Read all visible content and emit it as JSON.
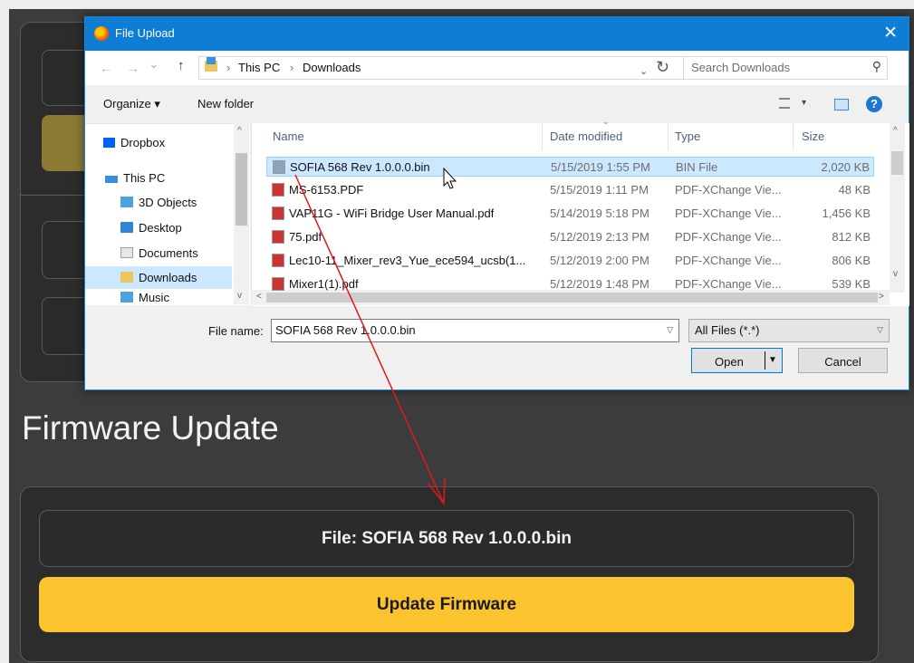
{
  "firmware": {
    "title": "Firmware Update",
    "file_label": "File: SOFIA 568 Rev 1.0.0.0.bin",
    "update_button": "Update Firmware"
  },
  "dialog": {
    "title": "File Upload",
    "close_glyph": "✕",
    "nav": {
      "back": "←",
      "forward": "→",
      "recent": "⌄",
      "up": "↑"
    },
    "breadcrumb": [
      "This PC",
      "Downloads"
    ],
    "breadcrumb_sep": "›",
    "search_placeholder": "Search Downloads",
    "toolbar": {
      "organize": "Organize ▾",
      "new_folder": "New folder",
      "help": "?"
    },
    "nav_items": [
      {
        "label": "Dropbox",
        "icon": "dropbox-icon",
        "color": "#0061fe"
      },
      {
        "label": "This PC",
        "icon": "computer-icon",
        "color": "#3a8fd9"
      },
      {
        "label": "3D Objects",
        "icon": "folder-icon",
        "color": "#4aa3df"
      },
      {
        "label": "Desktop",
        "icon": "desktop-icon",
        "color": "#2f84d8"
      },
      {
        "label": "Documents",
        "icon": "documents-icon",
        "color": "#9aa0a6"
      },
      {
        "label": "Downloads",
        "icon": "downloads-icon",
        "color": "#2f84d8"
      },
      {
        "label": "Music",
        "icon": "music-icon",
        "color": "#4aa3df"
      }
    ],
    "columns": [
      "Name",
      "Date modified",
      "Type",
      "Size"
    ],
    "files": [
      {
        "name": "SOFIA 568 Rev 1.0.0.0.bin",
        "date": "5/15/2019 1:55 PM",
        "type": "BIN File",
        "size": "2,020 KB"
      },
      {
        "name": "MS-6153.PDF",
        "date": "5/15/2019 1:11 PM",
        "type": "PDF-XChange Vie...",
        "size": "48 KB"
      },
      {
        "name": "VAP11G - WiFi Bridge User Manual.pdf",
        "date": "5/14/2019 5:18 PM",
        "type": "PDF-XChange Vie...",
        "size": "1,456 KB"
      },
      {
        "name": "75.pdf",
        "date": "5/12/2019 2:13 PM",
        "type": "PDF-XChange Vie...",
        "size": "812 KB"
      },
      {
        "name": "Lec10-11_Mixer_rev3_Yue_ece594_ucsb(1...",
        "date": "5/12/2019 2:00 PM",
        "type": "PDF-XChange Vie...",
        "size": "806 KB"
      },
      {
        "name": "Mixer1(1).pdf",
        "date": "5/12/2019 1:48 PM",
        "type": "PDF-XChange Vie...",
        "size": "539 KB"
      }
    ],
    "file_name_label": "File name:",
    "file_name_value": "SOFIA 568 Rev 1.0.0.0.bin",
    "file_type_value": "All Files (*.*)",
    "open_button": "Open",
    "cancel_button": "Cancel"
  },
  "colors": {
    "page_bg": "#3c3c3c",
    "accent_yellow": "#fbc42f",
    "titlebar_blue": "#0f7dd3",
    "selection_blue": "#cce8ff",
    "annotation_red": "#e21818"
  }
}
